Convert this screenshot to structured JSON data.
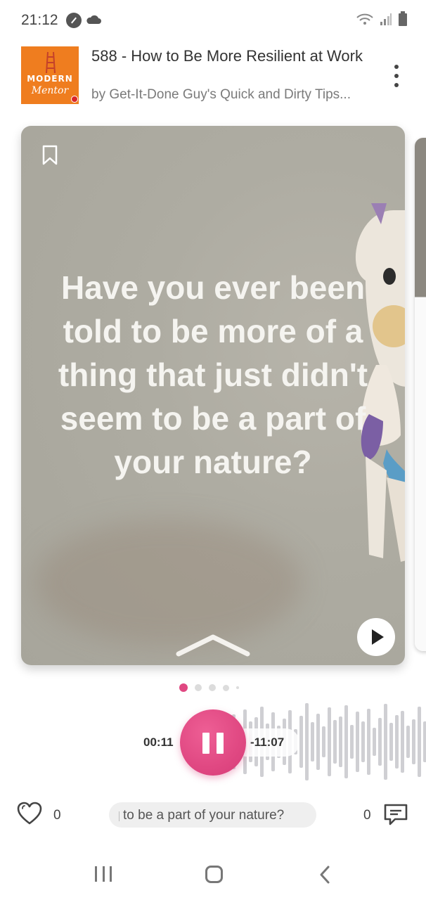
{
  "status_bar": {
    "time": "21:12"
  },
  "episode": {
    "title": "588 - How to Be More Resilient at Work",
    "author": "by Get-It-Done Guy's Quick and Dirty Tips..."
  },
  "artwork": {
    "line1": "MODERN",
    "line2": "Mentor",
    "background_color": "#ef7d1f"
  },
  "card": {
    "quote": "Have you ever been told to be more of a thing that just didn't seem to be a part of your nature?"
  },
  "pager": {
    "active_index": 0,
    "count": 5
  },
  "player": {
    "elapsed": "00:11",
    "remaining": "-11:07",
    "accent_color": "#e04882"
  },
  "actions": {
    "like_count": "0",
    "transcript_snippet": "to be a part of your nature?",
    "comment_count": "0"
  },
  "icons": {
    "bookmark": "bookmark-icon",
    "play": "play-icon",
    "pause": "pause-icon",
    "heart": "heart-icon",
    "comment": "comment-icon",
    "more": "more-vertical-icon"
  }
}
